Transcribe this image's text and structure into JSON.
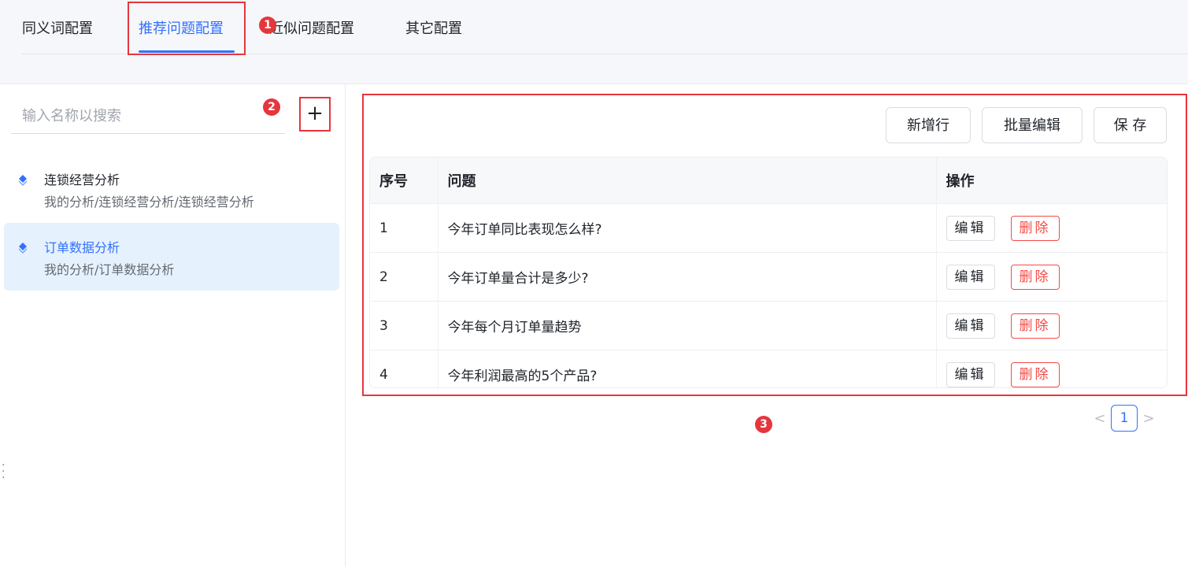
{
  "tabs": [
    {
      "label": "同义词配置"
    },
    {
      "label": "推荐问题配置"
    },
    {
      "label": "近似问题配置"
    },
    {
      "label": "其它配置"
    }
  ],
  "annotations": [
    "1",
    "2",
    "3"
  ],
  "sidebar": {
    "search_placeholder": "输入名称以搜索",
    "add_label": "+",
    "items": [
      {
        "title": "连锁经营分析",
        "path": "我的分析/连锁经营分析/连锁经营分析",
        "selected": false
      },
      {
        "title": "订单数据分析",
        "path": "我的分析/订单数据分析",
        "selected": true
      }
    ]
  },
  "toolbar": {
    "add_row": "新增行",
    "batch_edit": "批量编辑",
    "save": "保 存"
  },
  "table": {
    "headers": [
      "序号",
      "问题",
      "操作"
    ],
    "edit_label": "编辑",
    "delete_label": "删除",
    "rows": [
      {
        "index": "1",
        "question": "今年订单同比表现怎么样?"
      },
      {
        "index": "2",
        "question": "今年订单量合计是多少?"
      },
      {
        "index": "3",
        "question": "今年每个月订单量趋势"
      },
      {
        "index": "4",
        "question": "今年利润最高的5个产品?"
      }
    ]
  },
  "pagination": {
    "prev": "<",
    "current": "1",
    "next": ">"
  },
  "colors": {
    "accent": "#3370ff",
    "danger": "#f54a45",
    "annotation": "#e5363d",
    "selected_bg": "#e5f1fd"
  },
  "icons": {
    "tree_item": "diamond-icon",
    "add": "plus-icon",
    "resize": "vertical-ellipsis-icon"
  }
}
